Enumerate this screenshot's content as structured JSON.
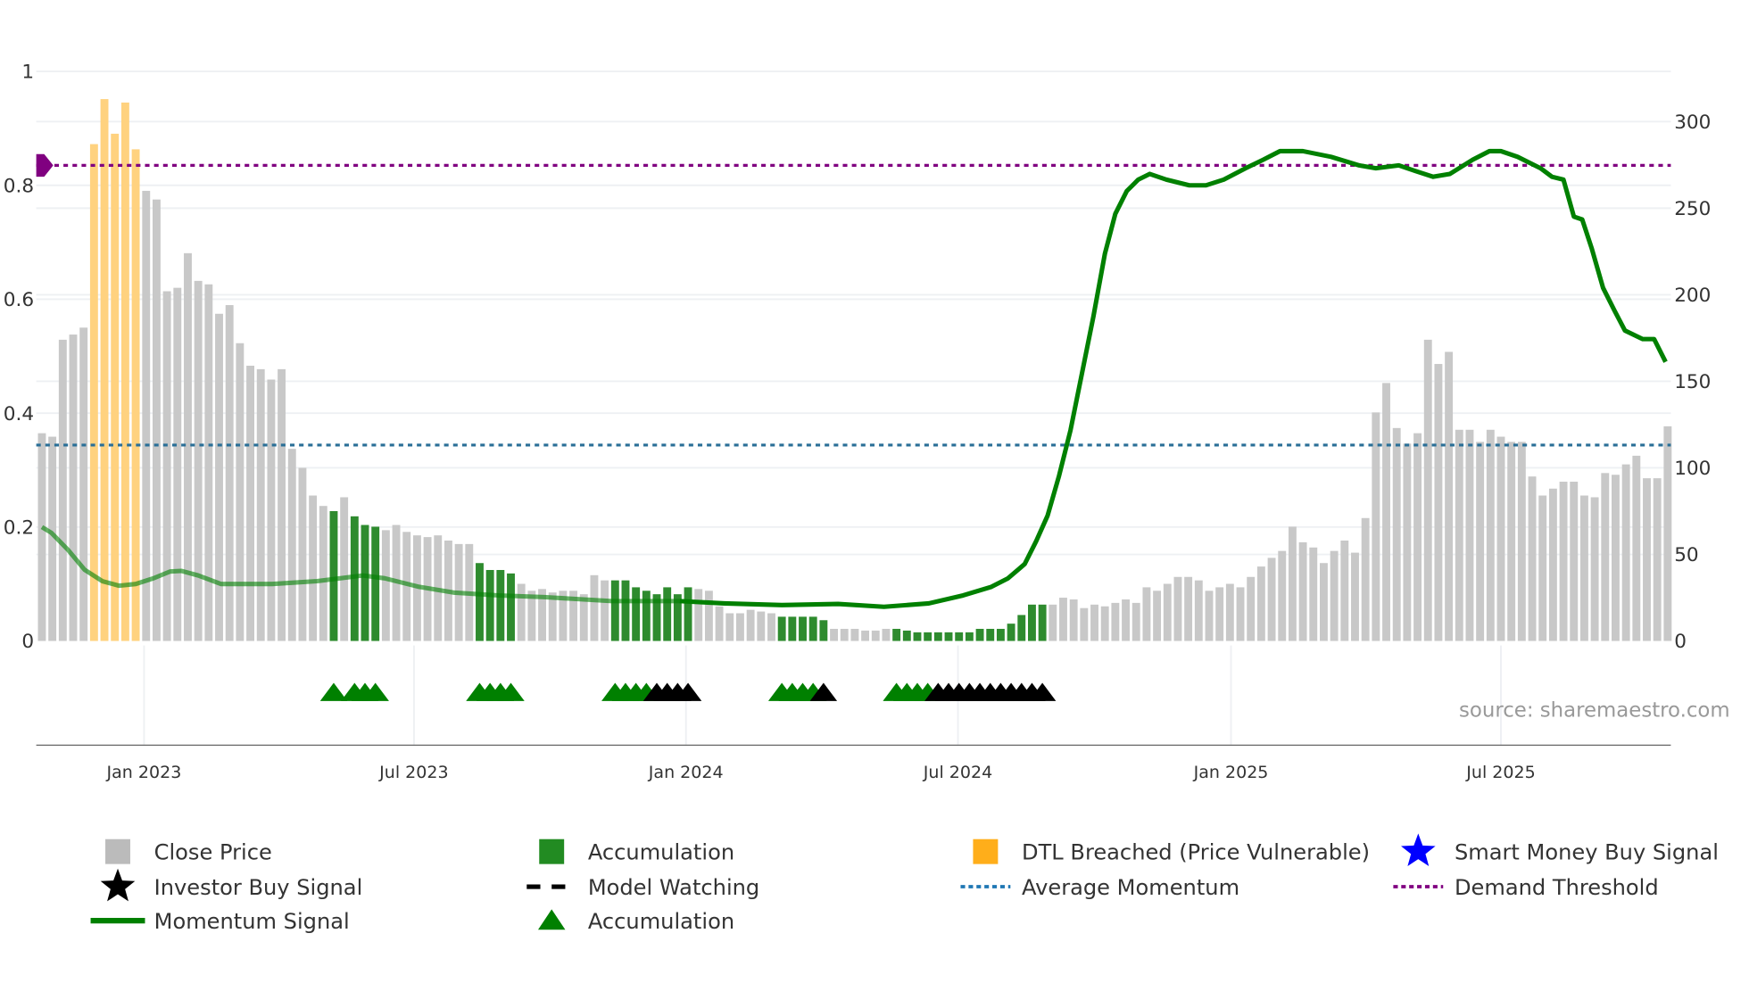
{
  "chart_data": {
    "type": "bar",
    "title": "",
    "source": "source: sharemaestro.com",
    "left_axis": {
      "ticks": [
        "0",
        "0.2",
        "0.4",
        "0.6",
        "0.8",
        "1"
      ],
      "values": [
        0,
        0.2,
        0.4,
        0.6,
        0.8,
        1
      ],
      "range": [
        0,
        1
      ]
    },
    "right_axis": {
      "ticks": [
        "0",
        "50",
        "100",
        "150",
        "200",
        "250",
        "300"
      ],
      "values": [
        0,
        50,
        100,
        150,
        200,
        250,
        300
      ],
      "range": [
        0,
        329
      ]
    },
    "x_ticks": [
      {
        "label": "Jan 2023",
        "index": 9.8
      },
      {
        "label": "Jul 2023",
        "index": 35.7
      },
      {
        "label": "Jan 2024",
        "index": 61.8
      },
      {
        "label": "Jul 2024",
        "index": 87.9
      },
      {
        "label": "Jan 2025",
        "index": 114.1
      },
      {
        "label": "Jul 2025",
        "index": 140
      }
    ],
    "close_price": [
      120,
      118,
      174,
      177,
      181,
      287,
      313,
      293,
      311,
      284,
      260,
      255,
      202,
      204,
      224,
      208,
      206,
      189,
      194,
      172,
      159,
      157,
      151,
      157,
      111,
      100,
      84,
      78,
      75,
      83,
      72,
      67,
      66,
      64,
      67,
      63,
      61,
      60,
      61,
      58,
      56,
      56,
      45,
      41,
      41,
      39,
      33,
      29,
      30,
      28,
      29,
      29,
      27,
      38,
      35,
      35,
      35,
      31,
      29,
      27,
      31,
      27,
      31,
      30,
      29,
      20,
      16,
      16,
      18,
      17,
      16,
      14,
      14,
      14,
      14,
      12,
      7,
      7,
      7,
      6,
      6,
      7,
      7,
      6,
      5,
      5,
      5,
      5,
      5,
      5,
      7,
      7,
      7,
      10,
      15,
      21,
      21,
      21,
      25,
      24,
      19,
      21,
      20,
      22,
      24,
      22,
      31,
      29,
      33,
      37,
      37,
      35,
      29,
      31,
      33,
      31,
      37,
      43,
      48,
      52,
      66,
      57,
      54,
      45,
      52,
      58,
      51,
      71,
      132,
      149,
      123,
      114,
      120,
      174,
      160,
      167,
      122,
      122,
      115,
      122,
      118,
      115,
      115,
      95,
      84,
      88,
      92,
      92,
      84,
      83,
      97,
      96,
      102,
      107,
      94,
      94,
      124
    ],
    "bar_status": "GGGGGOOOOOGGGGGGGGGGGGGGGGGGAGAAAGGGGGGGGGAAAAGGGGGGGGGAAAAAAAAGGGGGGGGAAAAAGGGGGGAAAAAAAAAAAAAAAGGGGGGGGGGGGGGGGGGGGGGGGGGGGGGGGGGGGGGGGGGGGGGGGGGGGGGGGGGGGGG",
    "momentum_signal": [
      [
        0,
        0.2
      ],
      [
        0.9,
        0.19
      ],
      [
        2.5,
        0.16
      ],
      [
        4.1,
        0.125
      ],
      [
        5.8,
        0.105
      ],
      [
        7.4,
        0.097
      ],
      [
        9,
        0.1
      ],
      [
        10.7,
        0.11
      ],
      [
        12.3,
        0.122
      ],
      [
        13.4,
        0.123
      ],
      [
        15,
        0.115
      ],
      [
        17.2,
        0.1
      ],
      [
        22.1,
        0.1
      ],
      [
        26.4,
        0.105
      ],
      [
        30.8,
        0.115
      ],
      [
        32.9,
        0.11
      ],
      [
        36.2,
        0.095
      ],
      [
        39.5,
        0.085
      ],
      [
        43.8,
        0.08
      ],
      [
        48.2,
        0.077
      ],
      [
        54.7,
        0.07
      ],
      [
        61.2,
        0.07
      ],
      [
        65.5,
        0.066
      ],
      [
        71,
        0.063
      ],
      [
        76.4,
        0.065
      ],
      [
        80.8,
        0.06
      ],
      [
        85.1,
        0.066
      ],
      [
        88.4,
        0.08
      ],
      [
        91.1,
        0.095
      ],
      [
        92.7,
        0.11
      ],
      [
        94.3,
        0.135
      ],
      [
        95.4,
        0.175
      ],
      [
        96.5,
        0.22
      ],
      [
        97.6,
        0.29
      ],
      [
        98.7,
        0.37
      ],
      [
        99.8,
        0.47
      ],
      [
        100.9,
        0.57
      ],
      [
        102,
        0.68
      ],
      [
        103,
        0.75
      ],
      [
        104.1,
        0.79
      ],
      [
        105.2,
        0.81
      ],
      [
        106.3,
        0.82
      ],
      [
        107.9,
        0.81
      ],
      [
        110.1,
        0.8
      ],
      [
        111.7,
        0.8
      ],
      [
        113.4,
        0.81
      ],
      [
        115.5,
        0.83
      ],
      [
        117.2,
        0.845
      ],
      [
        118.8,
        0.86
      ],
      [
        121,
        0.86
      ],
      [
        123.7,
        0.85
      ],
      [
        126.4,
        0.835
      ],
      [
        128,
        0.83
      ],
      [
        130.2,
        0.835
      ],
      [
        131.8,
        0.825
      ],
      [
        133.5,
        0.815
      ],
      [
        135.1,
        0.82
      ],
      [
        137.3,
        0.845
      ],
      [
        138.9,
        0.86
      ],
      [
        140,
        0.86
      ],
      [
        141.6,
        0.85
      ],
      [
        143.8,
        0.83
      ],
      [
        144.9,
        0.815
      ],
      [
        146,
        0.81
      ],
      [
        147,
        0.745
      ],
      [
        147.8,
        0.74
      ],
      [
        148.7,
        0.69
      ],
      [
        149.8,
        0.62
      ],
      [
        150.9,
        0.58
      ],
      [
        151.9,
        0.545
      ],
      [
        153.6,
        0.53
      ],
      [
        154.7,
        0.53
      ],
      [
        155.8,
        0.49
      ]
    ],
    "faded_until_index": 62,
    "average_momentum": 0.344,
    "demand_threshold": 0.835,
    "accumulation_triangles": [
      28,
      30,
      31,
      32,
      42,
      43,
      44,
      45,
      55,
      56,
      57,
      58,
      71,
      72,
      73,
      74,
      82,
      83,
      84,
      85
    ],
    "investor_buy_signals": [
      59,
      60,
      61,
      62,
      75,
      86,
      87,
      88,
      89,
      90,
      91,
      92,
      93,
      94,
      95,
      96
    ],
    "legend": [
      {
        "label": "Close Price",
        "icon": "square",
        "color": "#bbbbbb"
      },
      {
        "label": "Accumulation",
        "icon": "square",
        "color": "#228b22"
      },
      {
        "label": "DTL Breached (Price Vulnerable)",
        "icon": "square",
        "color": "#ffae1a"
      },
      {
        "label": "Smart Money Buy Signal",
        "icon": "star",
        "color": "#0000ff"
      },
      {
        "label": "Investor Buy Signal",
        "icon": "star",
        "color": "#000000"
      },
      {
        "label": "Model Watching",
        "icon": "dashed-line",
        "color": "#000000"
      },
      {
        "label": "Average Momentum",
        "icon": "dotted-line",
        "color": "#1f77b4"
      },
      {
        "label": "Demand Threshold",
        "icon": "dotted-line",
        "color": "#800080"
      },
      {
        "label": "Momentum Signal",
        "icon": "line",
        "color": "#008000"
      },
      {
        "label": "Accumulation",
        "icon": "triangle",
        "color": "#008000"
      }
    ],
    "colors": {
      "gray": "#c8c8c8",
      "green": "#2e8b2e",
      "orange": "#ffd27f",
      "momentum": "#008000",
      "avg": "#2a6f97",
      "demand": "#800080"
    }
  }
}
